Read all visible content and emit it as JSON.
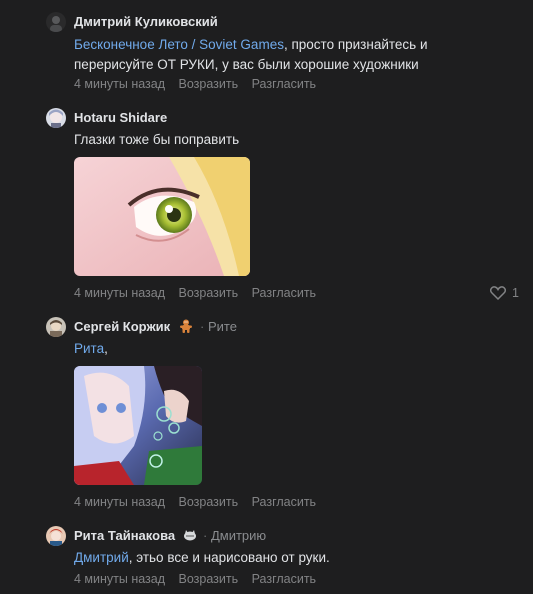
{
  "comments": [
    {
      "author": "Дмитрий Куликовский",
      "mention": "Бесконечное Лето / Soviet Games",
      "text": ", просто признайтесь и перерисуйте ОТ РУКИ, у вас были хорошие художники",
      "time": "4 минуты назад",
      "reply": "Возразить",
      "agree": "Разгласить"
    },
    {
      "author": "Hotaru Shidare",
      "text": "Глазки тоже бы поправить",
      "time": "4 минуты назад",
      "reply": "Возразить",
      "agree": "Разгласить",
      "likes": "1"
    },
    {
      "author": "Сергей Коржик",
      "reply_to": "Рите",
      "mention": "Рита",
      "text": ",",
      "time": "4 минуты назад",
      "reply": "Возразить",
      "agree": "Разгласить"
    },
    {
      "author": "Рита Тайнакова",
      "reply_to": "Дмитрию",
      "mention": "Дмитрий",
      "text": ", этьо все и нарисовано от руки.",
      "time": "4 минуты назад",
      "reply": "Возразить",
      "agree": "Разгласить"
    }
  ],
  "separator": "·",
  "colors": {
    "background": "#1e1e1f",
    "mention": "#71aaeb",
    "muted": "#828385"
  },
  "icons": {
    "like": "heart-outline-icon",
    "emoji_sergey": "gingerbread-emoji",
    "emoji_rita": "cat-emoji"
  }
}
